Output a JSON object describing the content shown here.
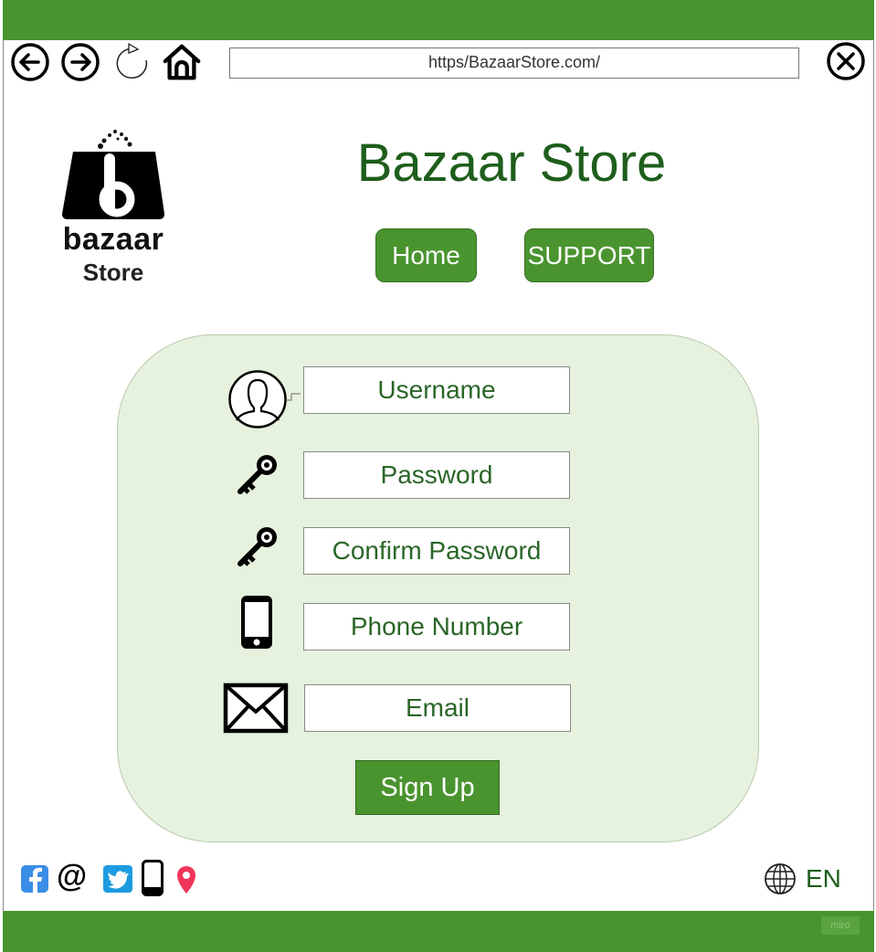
{
  "browser": {
    "url": "https/BazaarStore.com/"
  },
  "logo": {
    "line1": "bazaar",
    "line2": "Store"
  },
  "header": {
    "title": "Bazaar Store",
    "nav": {
      "home": "Home",
      "support": "SUPPORT"
    }
  },
  "form": {
    "username_placeholder": "Username",
    "password_placeholder": "Password",
    "confirm_placeholder": "Confirm Password",
    "phone_placeholder": "Phone Number",
    "email_placeholder": "Email",
    "submit_label": "Sign Up"
  },
  "footer": {
    "social_icons": [
      "facebook-icon",
      "at-sign-icon",
      "twitter-icon",
      "phone-icon",
      "location-pin-icon"
    ],
    "language": "EN",
    "watermark": "miro"
  },
  "colors": {
    "brand_green": "#4a942f",
    "title_green": "#1e5e1c",
    "panel_bg": "#e6f2de"
  }
}
